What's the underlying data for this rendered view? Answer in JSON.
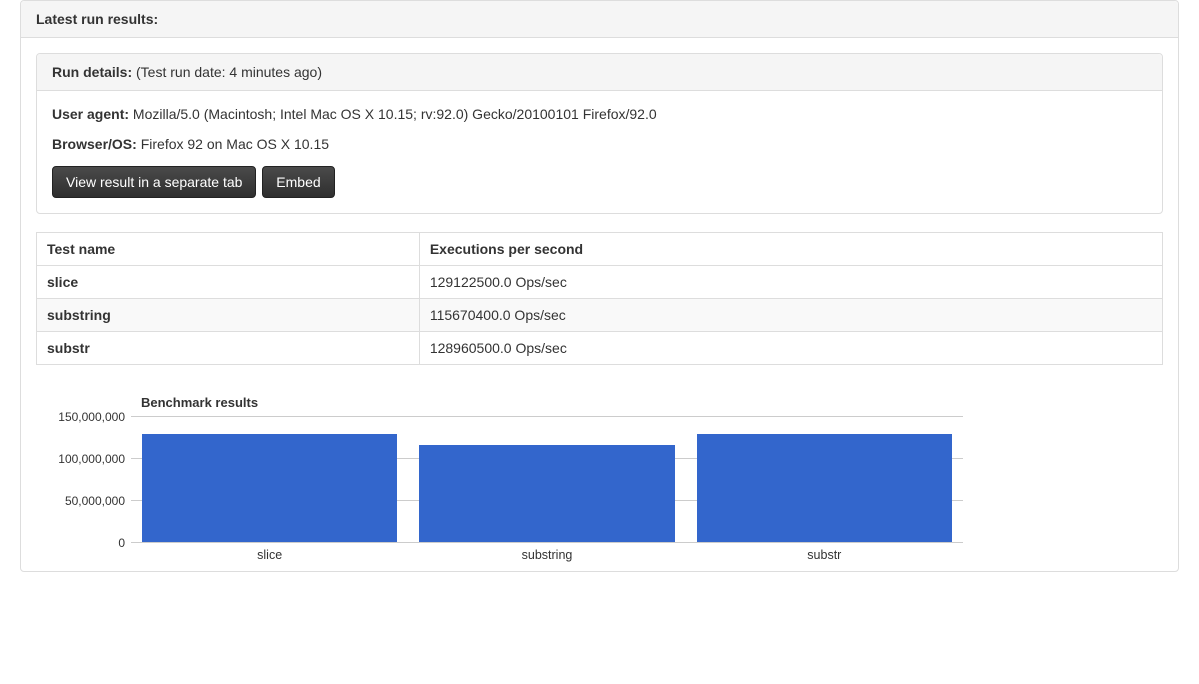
{
  "outer": {
    "heading": "Latest run results:"
  },
  "run_details": {
    "label": "Run details:",
    "date_text": "(Test run date: 4 minutes ago)",
    "user_agent_label": "User agent:",
    "user_agent_value": "Mozilla/5.0 (Macintosh; Intel Mac OS X 10.15; rv:92.0) Gecko/20100101 Firefox/92.0",
    "browser_os_label": "Browser/OS:",
    "browser_os_value": "Firefox 92 on Mac OS X 10.15",
    "view_button": "View result in a separate tab",
    "embed_button": "Embed"
  },
  "table": {
    "headers": [
      "Test name",
      "Executions per second"
    ],
    "rows": [
      {
        "name": "slice",
        "eps": "129122500.0 Ops/sec"
      },
      {
        "name": "substring",
        "eps": "115670400.0 Ops/sec"
      },
      {
        "name": "substr",
        "eps": "128960500.0 Ops/sec"
      }
    ]
  },
  "chart_data": {
    "type": "bar",
    "title": "Benchmark results",
    "categories": [
      "slice",
      "substring",
      "substr"
    ],
    "values": [
      129122500,
      115670400,
      128960500
    ],
    "ylim": [
      0,
      150000000
    ],
    "yticks": [
      0,
      50000000,
      100000000,
      150000000
    ],
    "ytick_labels": [
      "0",
      "50,000,000",
      "100,000,000",
      "150,000,000"
    ],
    "xlabel": "",
    "ylabel": ""
  }
}
